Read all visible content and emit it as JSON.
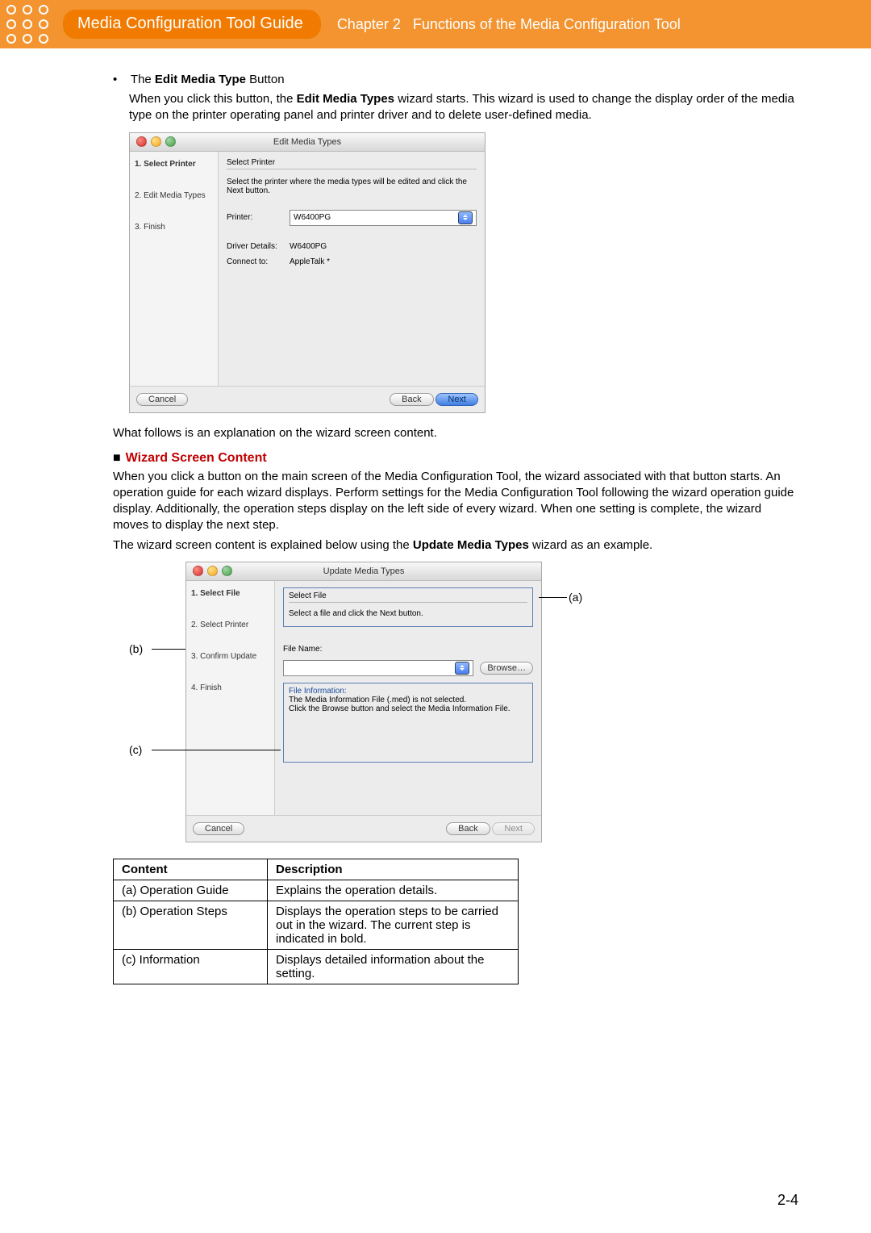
{
  "header": {
    "title": "Media Configuration Tool Guide",
    "chapter_label": "Chapter 2",
    "chapter_name": "Functions of the Media Configuration Tool"
  },
  "bullet1_pre": "The ",
  "bullet1_bold": "Edit Media Type",
  "bullet1_post": " Button",
  "para1a": "When you click this button, the ",
  "para1b_bold": "Edit Media Types",
  "para1c": " wizard starts. This wizard is used to change the display order of the media type on the printer operating panel and printer driver and to delete user-defined media.",
  "wiz1": {
    "title": "Edit Media Types",
    "step1": "1. Select Printer",
    "step2": "2. Edit Media Types",
    "step3": "3. Finish",
    "group_title": "Select Printer",
    "group_desc": "Select the printer where the media types will be edited and click the Next button.",
    "lbl_printer": "Printer:",
    "val_printer": "W6400PG",
    "lbl_driver": "Driver Details:",
    "val_driver": "W6400PG",
    "lbl_connect": "Connect to:",
    "val_connect": "AppleTalk  *",
    "btn_cancel": "Cancel",
    "btn_back": "Back",
    "btn_next": "Next"
  },
  "para2": "What follows is an explanation on the wizard screen content.",
  "section_title": "Wizard Screen Content",
  "para3": "When you click a button on the main screen of the Media Configuration Tool, the wizard associated with that button starts. An operation guide for each wizard displays. Perform settings for the Media Configuration Tool following the wizard operation guide display. Additionally, the operation steps display on the left side of every wizard. When one setting is complete, the wizard moves to display the next step.",
  "para4a": "The wizard screen content is explained below using the ",
  "para4b_bold": "Update Media Types",
  "para4c": " wizard as an example.",
  "wiz2": {
    "title": "Update Media Types",
    "step1": "1. Select File",
    "step2": "2. Select Printer",
    "step3": "3. Confirm Update",
    "step4": "4. Finish",
    "group_title": "Select File",
    "group_desc": "Select a file and click the Next button.",
    "lbl_file": "File Name:",
    "btn_browse": "Browse…",
    "info_title": "File Information:",
    "info_line1": "The Media Information File (.med) is not selected.",
    "info_line2": "Click the Browse button and select the Media Information File.",
    "btn_cancel": "Cancel",
    "btn_back": "Back",
    "btn_next": "Next"
  },
  "annot_a": "(a)",
  "annot_b": "(b)",
  "annot_c": "(c)",
  "table": {
    "h1": "Content",
    "h2": "Description",
    "r1c1": "(a) Operation Guide",
    "r1c2": "Explains the operation details.",
    "r2c1": "(b) Operation Steps",
    "r2c2": "Displays the operation steps to be carried out in the wizard. The current step is indicated in bold.",
    "r3c1": "(c) Information",
    "r3c2": "Displays detailed information about the setting."
  },
  "page_number": "2-4"
}
